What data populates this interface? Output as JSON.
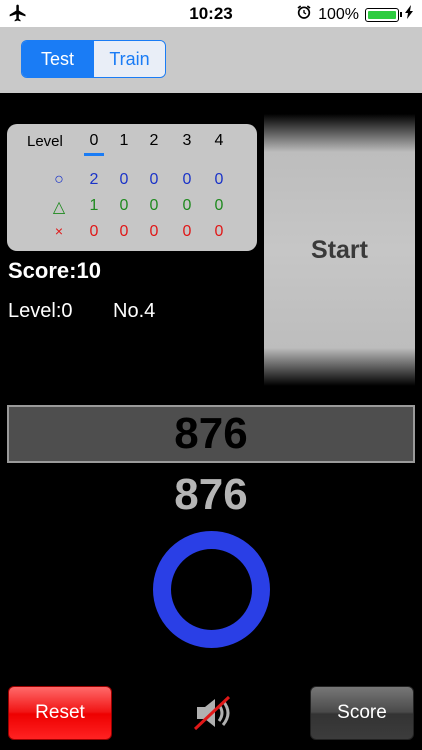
{
  "status_bar": {
    "time": "10:23",
    "battery": "100%",
    "battery_level": 1.0
  },
  "mode_toggle": {
    "options": [
      "Test",
      "Train"
    ],
    "selected": "Test"
  },
  "score_table": {
    "header_label": "Level",
    "levels": [
      "0",
      "1",
      "2",
      "3",
      "4"
    ],
    "selected_level": "0",
    "rows": [
      {
        "symbol": "○",
        "color": "#1a33c8",
        "values": [
          "2",
          "0",
          "0",
          "0",
          "0"
        ]
      },
      {
        "symbol": "△",
        "color": "#1f8a1f",
        "values": [
          "1",
          "0",
          "0",
          "0",
          "0"
        ]
      },
      {
        "symbol": "×",
        "color": "#e01818",
        "values": [
          "0",
          "0",
          "0",
          "0",
          "0"
        ]
      }
    ]
  },
  "score_text": "Score:10",
  "level_text": "Level:0",
  "number_text": "No.4",
  "start_button": {
    "label": "Start"
  },
  "answer_display": "876",
  "prompt_number": "876",
  "result_indicator": {
    "icon": "circle-ring-icon",
    "color": "#2a3fe6"
  },
  "bottom_bar": {
    "reset_label": "Reset",
    "score_label": "Score",
    "mute_icon": "speaker-muted-icon"
  }
}
